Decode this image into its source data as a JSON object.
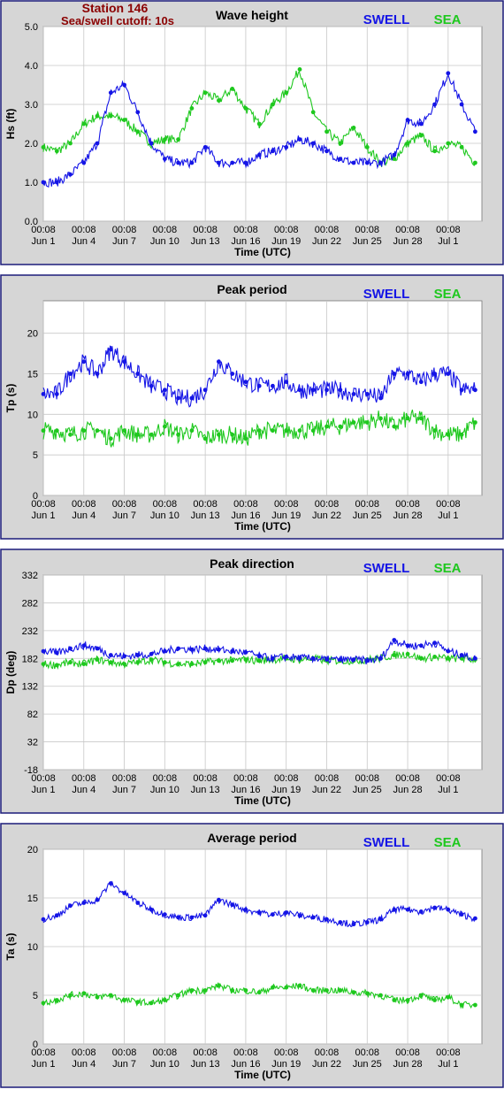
{
  "header": {
    "station": "Station 146",
    "cutoff": "Sea/swell cutoff: 10s"
  },
  "legend": {
    "swell": "SWELL",
    "sea": "SEA"
  },
  "colors": {
    "swell": "#1414e6",
    "sea": "#1ec81e",
    "header": "#8b0000",
    "frame": "#1c1c7a",
    "panel_bg": "#d6d6d6"
  },
  "x_axis": {
    "label": "Time (UTC)",
    "ticks": [
      {
        "time": "00:08",
        "date": "Jun 1"
      },
      {
        "time": "00:08",
        "date": "Jun 4"
      },
      {
        "time": "00:08",
        "date": "Jun 7"
      },
      {
        "time": "00:08",
        "date": "Jun 10"
      },
      {
        "time": "00:08",
        "date": "Jun 13"
      },
      {
        "time": "00:08",
        "date": "Jun 16"
      },
      {
        "time": "00:08",
        "date": "Jun 19"
      },
      {
        "time": "00:08",
        "date": "Jun 22"
      },
      {
        "time": "00:08",
        "date": "Jun 25"
      },
      {
        "time": "00:08",
        "date": "Jun 28"
      },
      {
        "time": "00:08",
        "date": "Jul 1"
      }
    ]
  },
  "chart_data": [
    {
      "type": "line",
      "title": "Wave height",
      "xlabel": "Time (UTC)",
      "ylabel": "Hs (ft)",
      "yticks": [
        "0.0",
        "1.0",
        "2.0",
        "3.0",
        "4.0",
        "5.0"
      ],
      "ylim": [
        0,
        5
      ],
      "x": [
        0,
        1,
        2,
        3,
        4,
        5,
        6,
        7,
        8,
        9,
        10,
        11,
        12,
        13,
        14,
        15,
        16,
        17,
        18,
        19,
        20,
        21,
        22,
        23,
        24,
        25,
        26,
        27,
        28,
        29,
        30,
        31,
        32
      ],
      "series": [
        {
          "name": "SWELL",
          "values": [
            1.0,
            1.0,
            1.2,
            1.5,
            2.0,
            3.3,
            3.5,
            2.8,
            2.0,
            1.6,
            1.5,
            1.5,
            1.9,
            1.5,
            1.5,
            1.5,
            1.7,
            1.8,
            1.9,
            2.1,
            2.0,
            1.8,
            1.6,
            1.5,
            1.5,
            1.5,
            1.7,
            2.6,
            2.5,
            3.0,
            3.8,
            3.0,
            2.3
          ]
        },
        {
          "name": "SEA",
          "values": [
            1.9,
            1.8,
            2.0,
            2.5,
            2.7,
            2.7,
            2.6,
            2.3,
            2.0,
            2.1,
            2.1,
            2.9,
            3.3,
            3.1,
            3.4,
            2.9,
            2.5,
            3.0,
            3.3,
            3.9,
            2.8,
            2.3,
            2.0,
            2.4,
            1.9,
            1.5,
            1.6,
            2.0,
            2.2,
            1.8,
            2.0,
            1.9,
            1.5
          ]
        }
      ]
    },
    {
      "type": "line",
      "title": "Peak period",
      "xlabel": "Time (UTC)",
      "ylabel": "Tp (s)",
      "yticks": [
        "0",
        "5",
        "10",
        "15",
        "20"
      ],
      "ylim": [
        0,
        24
      ],
      "x": [
        0,
        1,
        2,
        3,
        4,
        5,
        6,
        7,
        8,
        9,
        10,
        11,
        12,
        13,
        14,
        15,
        16,
        17,
        18,
        19,
        20,
        21,
        22,
        23,
        24,
        25,
        26,
        27,
        28,
        29,
        30,
        31,
        32
      ],
      "series": [
        {
          "name": "SWELL",
          "values": [
            12.5,
            12.5,
            15,
            16.5,
            15,
            18,
            16.5,
            15,
            13.5,
            13,
            12,
            12,
            13,
            16.5,
            15,
            14,
            13.5,
            13.5,
            14,
            13,
            13,
            13,
            13,
            12.5,
            12.5,
            12,
            15,
            15,
            14,
            15,
            15,
            13,
            13
          ]
        },
        {
          "name": "SEA",
          "values": [
            8,
            8,
            7.5,
            8,
            8,
            7,
            8,
            7.5,
            7.5,
            8.5,
            7.5,
            8,
            7,
            7.5,
            7.5,
            7,
            8,
            8,
            8,
            8,
            8,
            8.5,
            8.5,
            9,
            9,
            9.5,
            8.5,
            9.5,
            9.5,
            8,
            7.5,
            7.5,
            9
          ]
        }
      ]
    },
    {
      "type": "line",
      "title": "Peak direction",
      "xlabel": "Time (UTC)",
      "ylabel": "Dp (deg)",
      "yticks": [
        "-18",
        "32",
        "82",
        "132",
        "182",
        "232",
        "282",
        "332"
      ],
      "ylim": [
        -18,
        332
      ],
      "x": [
        0,
        1,
        2,
        3,
        4,
        5,
        6,
        7,
        8,
        9,
        10,
        11,
        12,
        13,
        14,
        15,
        16,
        17,
        18,
        19,
        20,
        21,
        22,
        23,
        24,
        25,
        26,
        27,
        28,
        29,
        30,
        31,
        32
      ],
      "series": [
        {
          "name": "SWELL",
          "values": [
            195,
            192,
            200,
            205,
            200,
            188,
            186,
            188,
            190,
            195,
            200,
            198,
            200,
            198,
            195,
            193,
            186,
            182,
            185,
            183,
            182,
            180,
            180,
            180,
            178,
            182,
            215,
            205,
            205,
            210,
            195,
            188,
            182
          ]
        },
        {
          "name": "SEA",
          "values": [
            172,
            170,
            175,
            172,
            180,
            175,
            172,
            175,
            180,
            175,
            172,
            172,
            175,
            178,
            178,
            180,
            178,
            180,
            182,
            180,
            182,
            178,
            178,
            178,
            180,
            182,
            188,
            190,
            182,
            185,
            182,
            182,
            180
          ]
        }
      ]
    },
    {
      "type": "line",
      "title": "Average period",
      "xlabel": "Time (UTC)",
      "ylabel": "Ta (s)",
      "yticks": [
        "0",
        "5",
        "10",
        "15",
        "20"
      ],
      "ylim": [
        0,
        20
      ],
      "x": [
        0,
        1,
        2,
        3,
        4,
        5,
        6,
        7,
        8,
        9,
        10,
        11,
        12,
        13,
        14,
        15,
        16,
        17,
        18,
        19,
        20,
        21,
        22,
        23,
        24,
        25,
        26,
        27,
        28,
        29,
        30,
        31,
        32
      ],
      "series": [
        {
          "name": "SWELL",
          "values": [
            12.8,
            13.2,
            14.2,
            14.5,
            14.8,
            16.5,
            15.5,
            14.5,
            13.8,
            13.3,
            13.0,
            13.0,
            13.2,
            14.8,
            14.3,
            13.8,
            13.5,
            13.3,
            13.5,
            13.2,
            13.0,
            12.8,
            12.5,
            12.3,
            12.5,
            12.8,
            13.8,
            13.8,
            13.6,
            14.0,
            13.8,
            13.3,
            12.9
          ]
        },
        {
          "name": "SEA",
          "values": [
            4.2,
            4.5,
            5.0,
            5.2,
            4.8,
            5.0,
            4.5,
            4.3,
            4.2,
            4.5,
            5.0,
            5.5,
            5.5,
            6.0,
            5.5,
            5.5,
            5.3,
            5.8,
            5.8,
            6.0,
            5.5,
            5.5,
            5.5,
            5.3,
            5.2,
            5.0,
            4.5,
            4.5,
            5.0,
            4.5,
            4.8,
            4.0,
            4.0
          ]
        }
      ]
    }
  ]
}
